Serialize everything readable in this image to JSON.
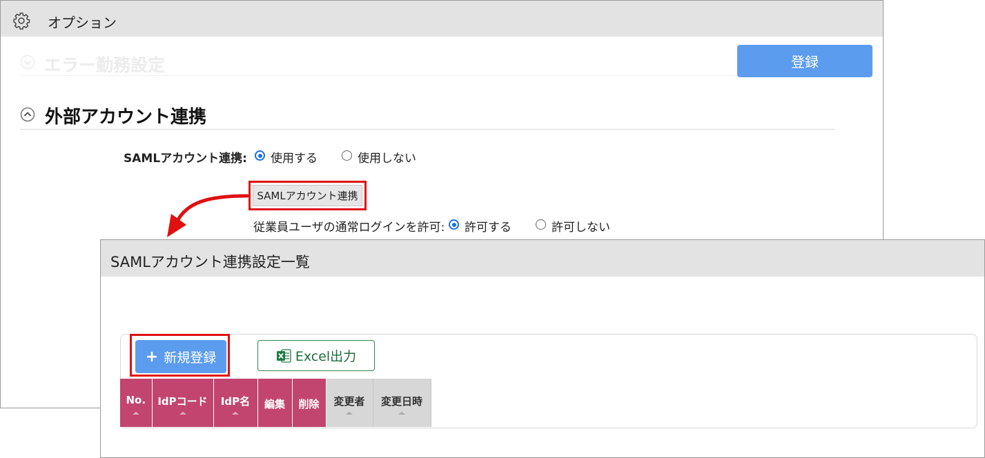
{
  "window1": {
    "title": "オプション",
    "faded_section_title": "エラー勤務設定",
    "register_button": "登録",
    "external_section_title": "外部アカウント連携",
    "saml_label": "SAMLアカウント連携:",
    "saml_options": [
      "使用する",
      "使用しない"
    ],
    "saml_selected": "使用する",
    "saml_button": "SAMLアカウント連携",
    "login_label": "従業員ユーザの通常ログインを許可:",
    "login_options": [
      "許可する",
      "許可しない"
    ],
    "login_selected": "許可する"
  },
  "window2": {
    "title": "SAMLアカウント連携設定一覧",
    "new_button": "新規登録",
    "new_button_icon": "plus-icon",
    "excel_button": "Excel出力",
    "excel_button_icon": "excel-icon",
    "table_headers": [
      "No.",
      "IdPコード",
      "IdP名",
      "編集",
      "削除",
      "変更者",
      "変更日時"
    ]
  },
  "colors": {
    "primary": "#5b9cef",
    "header_pink": "#c2456f",
    "header_gray": "#d7d7d7",
    "highlight_red": "#e01010",
    "excel_green": "#2a8a4b"
  }
}
